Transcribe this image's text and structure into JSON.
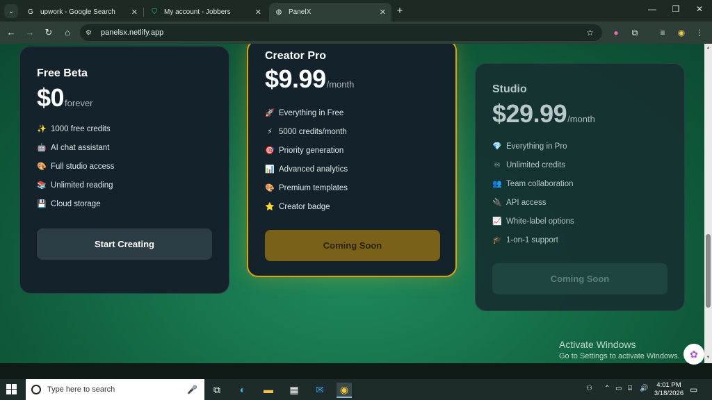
{
  "browser": {
    "tabs": [
      {
        "label": "upwork - Google Search",
        "icon": "google-icon",
        "active": false
      },
      {
        "label": "My account - Jobbers",
        "icon": "jobbers-icon",
        "active": false
      },
      {
        "label": "PanelX",
        "icon": "globe-icon",
        "active": true
      }
    ],
    "url": "panelsx.netlify.app"
  },
  "pricing": {
    "plans": [
      {
        "name": "Free Beta",
        "price": "$0",
        "period": "forever",
        "features": [
          {
            "icon": "✨",
            "label": "1000 free credits"
          },
          {
            "icon": "🤖",
            "label": "AI chat assistant"
          },
          {
            "icon": "🎨",
            "label": "Full studio access"
          },
          {
            "icon": "📚",
            "label": "Unlimited reading"
          },
          {
            "icon": "💾",
            "label": "Cloud storage"
          }
        ],
        "cta": "Start Creating"
      },
      {
        "name": "Creator Pro",
        "price": "$9.99",
        "period": "/month",
        "features": [
          {
            "icon": "🚀",
            "label": "Everything in Free"
          },
          {
            "icon": "⚡",
            "label": "5000 credits/month"
          },
          {
            "icon": "🎯",
            "label": "Priority generation"
          },
          {
            "icon": "📊",
            "label": "Advanced analytics"
          },
          {
            "icon": "🎨",
            "label": "Premium templates"
          },
          {
            "icon": "⭐",
            "label": "Creator badge"
          }
        ],
        "cta": "Coming Soon"
      },
      {
        "name": "Studio",
        "price": "$29.99",
        "period": "/month",
        "features": [
          {
            "icon": "💎",
            "label": "Everything in Pro"
          },
          {
            "icon": "♾",
            "label": "Unlimited credits"
          },
          {
            "icon": "👥",
            "label": "Team collaboration"
          },
          {
            "icon": "🔌",
            "label": "API access"
          },
          {
            "icon": "📈",
            "label": "White-label options"
          },
          {
            "icon": "🎓",
            "label": "1-on-1 support"
          }
        ],
        "cta": "Coming Soon"
      }
    ]
  },
  "watermark": {
    "line1": "Activate Windows",
    "line2": "Go to Settings to activate Windows."
  },
  "taskbar": {
    "search_placeholder": "Type here to search",
    "time": "4:01 PM",
    "date": "3/18/2026"
  }
}
